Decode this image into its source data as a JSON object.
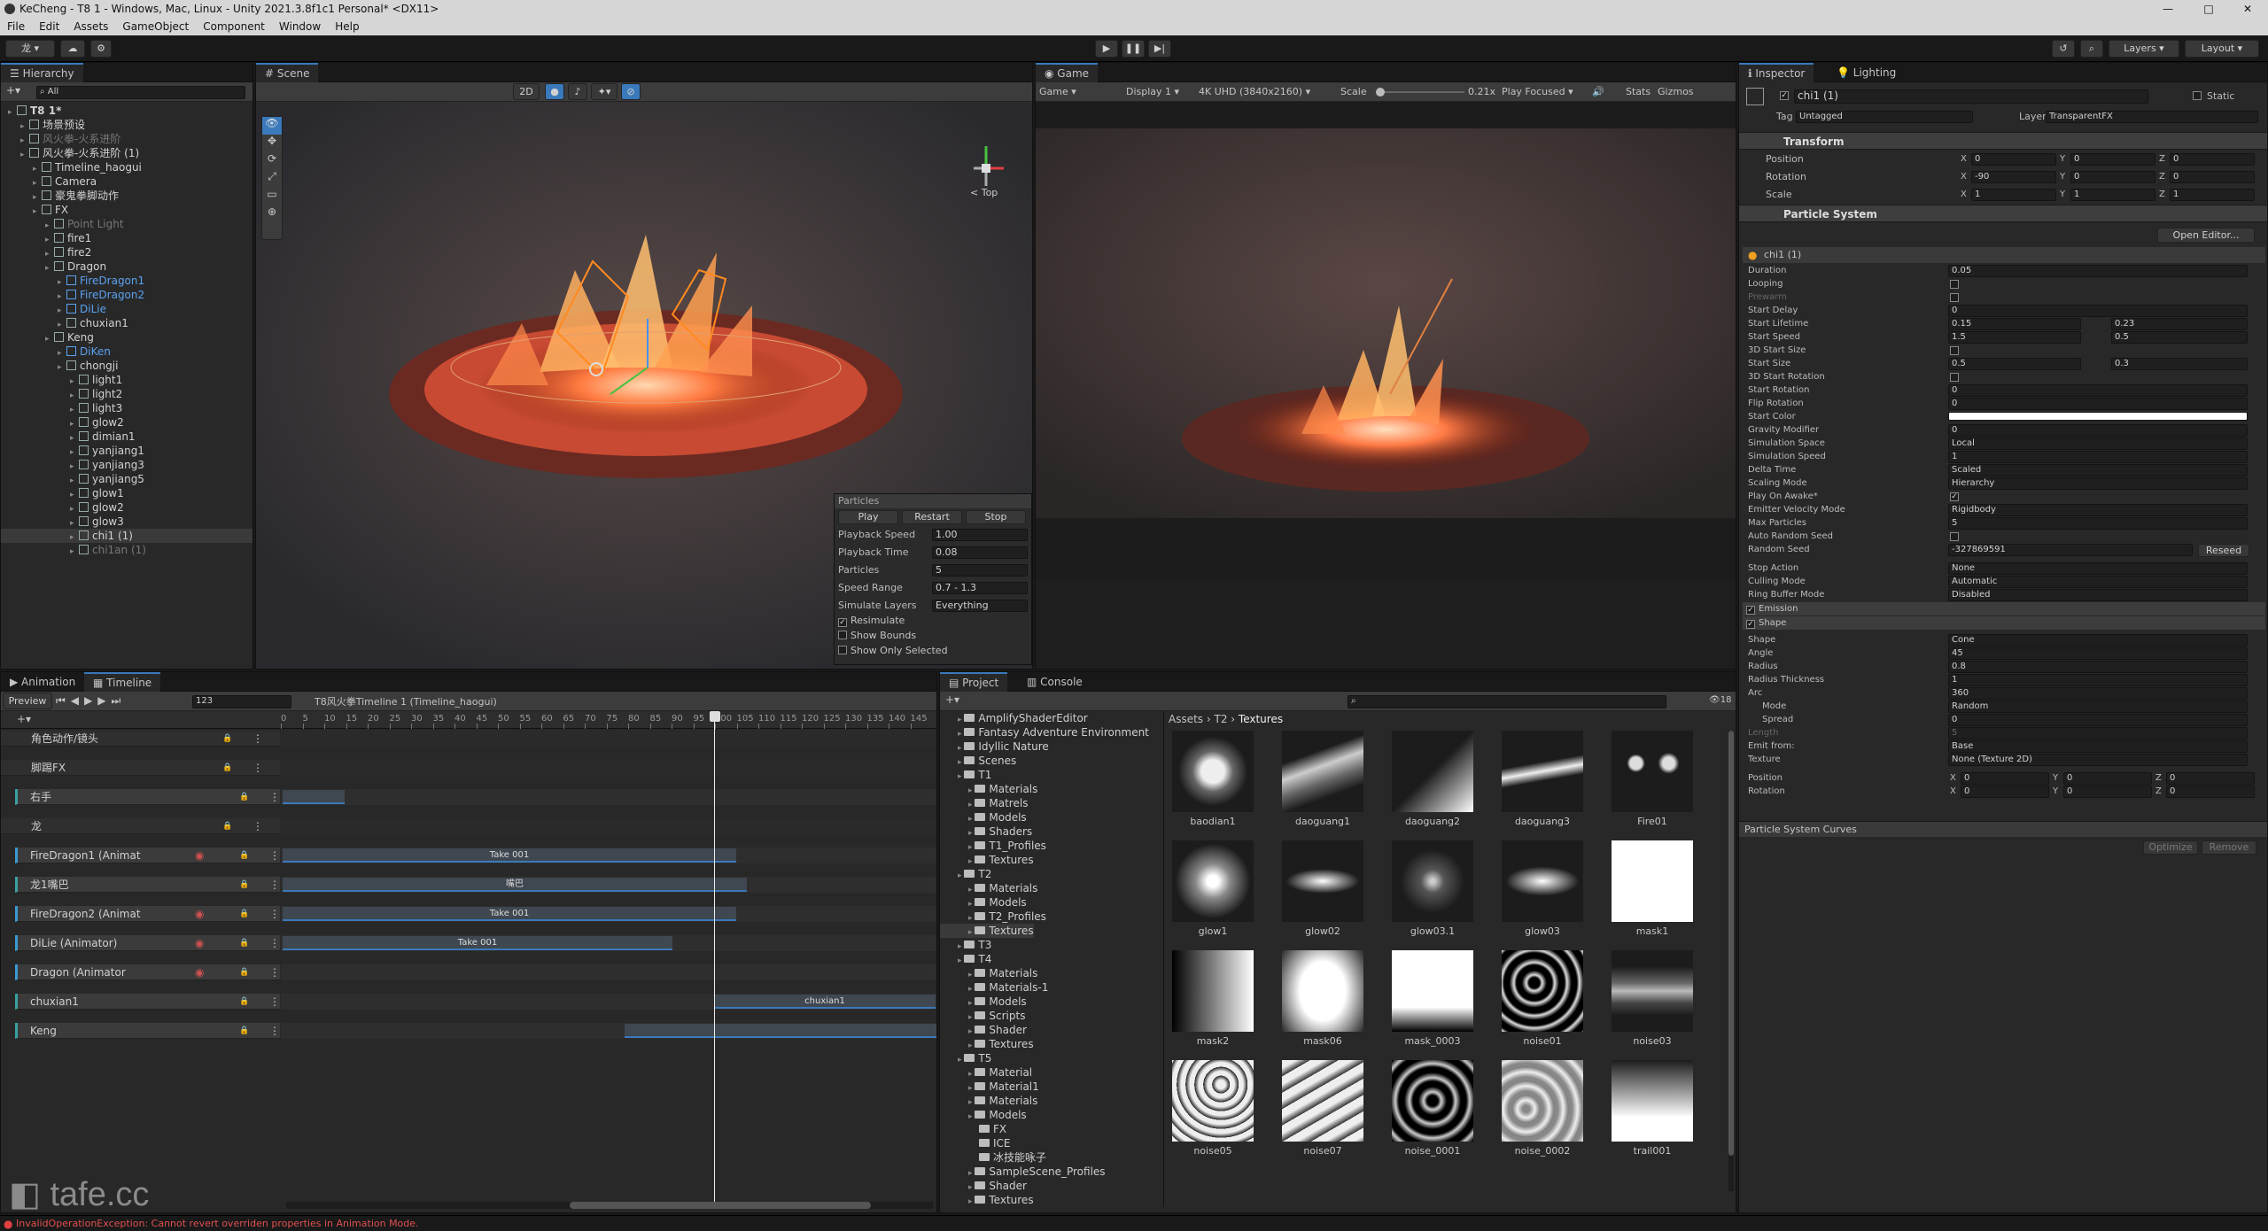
{
  "window": {
    "title": "KeCheng - T8 1 - Windows, Mac, Linux - Unity 2021.3.8f1c1 Personal* <DX11>"
  },
  "menu": [
    "File",
    "Edit",
    "Assets",
    "GameObject",
    "Component",
    "Window",
    "Help"
  ],
  "toolbar": {
    "account": "龙",
    "layers": "Layers",
    "layout": "Layout"
  },
  "hierarchy": {
    "tab": "Hierarchy",
    "search_placeholder": "All",
    "rows": [
      {
        "label": "T8 1*",
        "indent": 0,
        "style": "bold"
      },
      {
        "label": "场景预设",
        "indent": 1,
        "style": ""
      },
      {
        "label": "风火拳-火系进阶",
        "indent": 1,
        "style": "gray"
      },
      {
        "label": "风火拳-火系进阶 (1)",
        "indent": 1,
        "style": ""
      },
      {
        "label": "Timeline_haogui",
        "indent": 2,
        "style": ""
      },
      {
        "label": "Camera",
        "indent": 2,
        "style": ""
      },
      {
        "label": "豪鬼拳脚动作",
        "indent": 2,
        "style": ""
      },
      {
        "label": "FX",
        "indent": 2,
        "style": ""
      },
      {
        "label": "Point Light",
        "indent": 3,
        "style": "gray"
      },
      {
        "label": "fire1",
        "indent": 3,
        "style": ""
      },
      {
        "label": "fire2",
        "indent": 3,
        "style": ""
      },
      {
        "label": "Dragon",
        "indent": 3,
        "style": ""
      },
      {
        "label": "FireDragon1",
        "indent": 4,
        "style": "blue"
      },
      {
        "label": "FireDragon2",
        "indent": 4,
        "style": "blue"
      },
      {
        "label": "DiLie",
        "indent": 4,
        "style": "blue"
      },
      {
        "label": "chuxian1",
        "indent": 4,
        "style": ""
      },
      {
        "label": "Keng",
        "indent": 3,
        "style": ""
      },
      {
        "label": "DiKen",
        "indent": 4,
        "style": "blue"
      },
      {
        "label": "chongji",
        "indent": 4,
        "style": ""
      },
      {
        "label": "light1",
        "indent": 5,
        "style": ""
      },
      {
        "label": "light2",
        "indent": 5,
        "style": ""
      },
      {
        "label": "light3",
        "indent": 5,
        "style": ""
      },
      {
        "label": "glow2",
        "indent": 5,
        "style": ""
      },
      {
        "label": "dimian1",
        "indent": 5,
        "style": ""
      },
      {
        "label": "yanjiang1",
        "indent": 5,
        "style": ""
      },
      {
        "label": "yanjiang3",
        "indent": 5,
        "style": ""
      },
      {
        "label": "yanjiang5",
        "indent": 5,
        "style": ""
      },
      {
        "label": "glow1",
        "indent": 5,
        "style": ""
      },
      {
        "label": "glow2",
        "indent": 5,
        "style": ""
      },
      {
        "label": "glow3",
        "indent": 5,
        "style": ""
      },
      {
        "label": "chi1 (1)",
        "indent": 5,
        "style": "sel"
      },
      {
        "label": "chi1an (1)",
        "indent": 5,
        "style": "gray"
      }
    ]
  },
  "scene": {
    "tab": "Scene",
    "mode_2d": "2D",
    "gizmo_label": "< Top",
    "particles": {
      "title": "Particles",
      "buttons": [
        "Play",
        "Restart",
        "Stop"
      ],
      "rows": [
        {
          "label": "Playback Speed",
          "value": "1.00"
        },
        {
          "label": "Playback Time",
          "value": "0.08"
        },
        {
          "label": "Particles",
          "value": "5"
        },
        {
          "label": "Speed Range",
          "value": "0.7 - 1.3"
        },
        {
          "label": "Simulate Layers",
          "value": "Everything"
        }
      ],
      "checks": [
        "Resimulate",
        "Show Bounds",
        "Show Only Selected"
      ]
    }
  },
  "game": {
    "tab": "Game",
    "mode": "Game",
    "display": "Display 1",
    "resolution": "4K UHD (3840x2160)",
    "scale_label": "Scale",
    "scale_value": "0.21x",
    "play_focused": "Play Focused",
    "stats": "Stats",
    "gizmos": "Gizmos"
  },
  "inspector": {
    "tabs": [
      "Inspector",
      "Lighting"
    ],
    "object_name": "chi1 (1)",
    "static": "Static",
    "tag_label": "Tag",
    "tag": "Untagged",
    "layer_label": "Layer",
    "layer": "TransparentFX",
    "transform": {
      "title": "Transform",
      "rows": [
        {
          "label": "Position",
          "x": "0",
          "y": "0",
          "z": "0"
        },
        {
          "label": "Rotation",
          "x": "-90",
          "y": "0",
          "z": "0"
        },
        {
          "label": "Scale",
          "x": "1",
          "y": "1",
          "z": "1"
        }
      ]
    },
    "particle_system": {
      "title": "Particle System",
      "open_editor": "Open Editor...",
      "module_name": "chi1 (1)",
      "props": [
        {
          "label": "Duration",
          "v1": "0.05",
          "v2": ""
        },
        {
          "label": "Looping",
          "v1": "",
          "v2": ""
        },
        {
          "label": "Prewarm",
          "v1": "",
          "v2": ""
        },
        {
          "label": "Start Delay",
          "v1": "0",
          "v2": ""
        },
        {
          "label": "Start Lifetime",
          "v1": "0.15",
          "v2": "0.23"
        },
        {
          "label": "Start Speed",
          "v1": "1.5",
          "v2": "0.5"
        },
        {
          "label": "3D Start Size",
          "v1": "",
          "v2": ""
        },
        {
          "label": "Start Size",
          "v1": "0.5",
          "v2": "0.3"
        },
        {
          "label": "3D Start Rotation",
          "v1": "",
          "v2": ""
        },
        {
          "label": "Start Rotation",
          "v1": "0",
          "v2": ""
        },
        {
          "label": "Flip Rotation",
          "v1": "0",
          "v2": ""
        },
        {
          "label": "Start Color",
          "v1": "",
          "v2": ""
        },
        {
          "label": "Gravity Modifier",
          "v1": "0",
          "v2": ""
        },
        {
          "label": "Simulation Space",
          "v1": "Local",
          "v2": ""
        },
        {
          "label": "Simulation Speed",
          "v1": "1",
          "v2": ""
        },
        {
          "label": "Delta Time",
          "v1": "Scaled",
          "v2": ""
        },
        {
          "label": "Scaling Mode",
          "v1": "Hierarchy",
          "v2": ""
        },
        {
          "label": "Play On Awake*",
          "v1": "",
          "v2": ""
        },
        {
          "label": "Emitter Velocity Mode",
          "v1": "Rigidbody",
          "v2": ""
        },
        {
          "label": "Max Particles",
          "v1": "5",
          "v2": ""
        },
        {
          "label": "Auto Random Seed",
          "v1": "",
          "v2": ""
        },
        {
          "label": "Random Seed",
          "v1": "-327869591",
          "v2": ""
        }
      ],
      "reseed": "Reseed",
      "props2": [
        {
          "label": "Stop Action",
          "v1": "None"
        },
        {
          "label": "Culling Mode",
          "v1": "Automatic"
        },
        {
          "label": "Ring Buffer Mode",
          "v1": "Disabled"
        }
      ],
      "modules": [
        "Emission",
        "Shape"
      ],
      "shape": [
        {
          "label": "Shape",
          "v1": "Cone"
        },
        {
          "label": "Angle",
          "v1": "45"
        },
        {
          "label": "Radius",
          "v1": "0.8"
        },
        {
          "label": "Radius Thickness",
          "v1": "1"
        },
        {
          "label": "Arc",
          "v1": "360"
        },
        {
          "label": "Mode",
          "v1": "Random"
        },
        {
          "label": "Spread",
          "v1": "0"
        },
        {
          "label": "Length",
          "v1": "5"
        },
        {
          "label": "Emit from:",
          "v1": "Base"
        },
        {
          "label": "Texture",
          "v1": "None (Texture 2D)"
        }
      ],
      "position": {
        "label": "Position",
        "x": "0",
        "y": "0",
        "z": "0"
      },
      "rotation": {
        "label": "Rotation",
        "x": "0",
        "y": "0",
        "z": "0"
      }
    },
    "curves": {
      "title": "Particle System Curves",
      "optimize": "Optimize",
      "remove": "Remove"
    }
  },
  "timeline": {
    "tabs": [
      "Animation",
      "Timeline"
    ],
    "preview": "Preview",
    "frame": "123",
    "asset": "T8风火拳Timeline 1 (Timeline_haogui)",
    "ruler": [
      "0",
      "5",
      "10",
      "15",
      "20",
      "25",
      "30",
      "35",
      "40",
      "45",
      "50",
      "55",
      "60",
      "65",
      "70",
      "75",
      "80",
      "85",
      "90",
      "95",
      "100",
      "105",
      "110",
      "115",
      "120",
      "125",
      "130",
      "135",
      "140",
      "145"
    ],
    "tracks": [
      {
        "label": "角色动作/镜头",
        "type": "group"
      },
      {
        "label": "脚踢FX",
        "type": "group"
      },
      {
        "label": "右手",
        "type": "track"
      },
      {
        "label": "龙",
        "type": "group"
      },
      {
        "label": "FireDragon1 (Animat",
        "type": "anim"
      },
      {
        "label": "龙1嘴巴",
        "type": "track"
      },
      {
        "label": "FireDragon2 (Animat",
        "type": "anim"
      },
      {
        "label": "DiLie (Animator)",
        "type": "anim"
      },
      {
        "label": "Dragon (Animator",
        "type": "anim"
      },
      {
        "label": "chuxian1",
        "type": "track"
      },
      {
        "label": "Keng",
        "type": "track"
      }
    ],
    "clips": {
      "take1": "Take 001",
      "take2": "Take 001",
      "take3": "Take 001",
      "mouth": "嘴巴",
      "chuxian": "chuxian1"
    }
  },
  "project": {
    "tabs": [
      "Project",
      "Console"
    ],
    "breadcrumb": [
      "Assets",
      "T2",
      "Textures"
    ],
    "folders": [
      {
        "label": "AmplifyShaderEditor",
        "indent": 1
      },
      {
        "label": "Fantasy Adventure Environment",
        "indent": 1
      },
      {
        "label": "Idyllic Nature",
        "indent": 1
      },
      {
        "label": "Scenes",
        "indent": 1
      },
      {
        "label": "T1",
        "indent": 1
      },
      {
        "label": "Materials",
        "indent": 2
      },
      {
        "label": "Matrels",
        "indent": 2
      },
      {
        "label": "Models",
        "indent": 2
      },
      {
        "label": "Shaders",
        "indent": 2
      },
      {
        "label": "T1_Profiles",
        "indent": 2
      },
      {
        "label": "Textures",
        "indent": 2
      },
      {
        "label": "T2",
        "indent": 1
      },
      {
        "label": "Materials",
        "indent": 2
      },
      {
        "label": "Models",
        "indent": 2
      },
      {
        "label": "T2_Profiles",
        "indent": 2
      },
      {
        "label": "Textures",
        "indent": 2
      },
      {
        "label": "T3",
        "indent": 1
      },
      {
        "label": "T4",
        "indent": 1
      },
      {
        "label": "Materials",
        "indent": 2
      },
      {
        "label": "Materials-1",
        "indent": 2
      },
      {
        "label": "Models",
        "indent": 2
      },
      {
        "label": "Scripts",
        "indent": 2
      },
      {
        "label": "Shader",
        "indent": 2
      },
      {
        "label": "Textures",
        "indent": 2
      },
      {
        "label": "T5",
        "indent": 1
      },
      {
        "label": "Material",
        "indent": 2
      },
      {
        "label": "Material1",
        "indent": 2
      },
      {
        "label": "Materials",
        "indent": 2
      },
      {
        "label": "Models",
        "indent": 2
      },
      {
        "label": "FX",
        "indent": 3
      },
      {
        "label": "ICE",
        "indent": 3
      },
      {
        "label": "冰技能咏子",
        "indent": 3
      },
      {
        "label": "SampleScene_Profiles",
        "indent": 2
      },
      {
        "label": "Shader",
        "indent": 2
      },
      {
        "label": "Textures",
        "indent": 2
      }
    ],
    "textures": [
      "baodian1",
      "daoguang1",
      "daoguang2",
      "daoguang3",
      "Fire01",
      "glow1",
      "glow02",
      "glow03.1",
      "glow03",
      "mask1",
      "mask2",
      "mask06",
      "mask_0003",
      "noise01",
      "noise03",
      "noise05",
      "noise07",
      "noise_0001",
      "noise_0002",
      "trail001"
    ],
    "count": "18"
  },
  "status": {
    "error": "InvalidOperationException: Cannot revert overriden properties in Animation Mode."
  },
  "watermark": "tafe.cc"
}
